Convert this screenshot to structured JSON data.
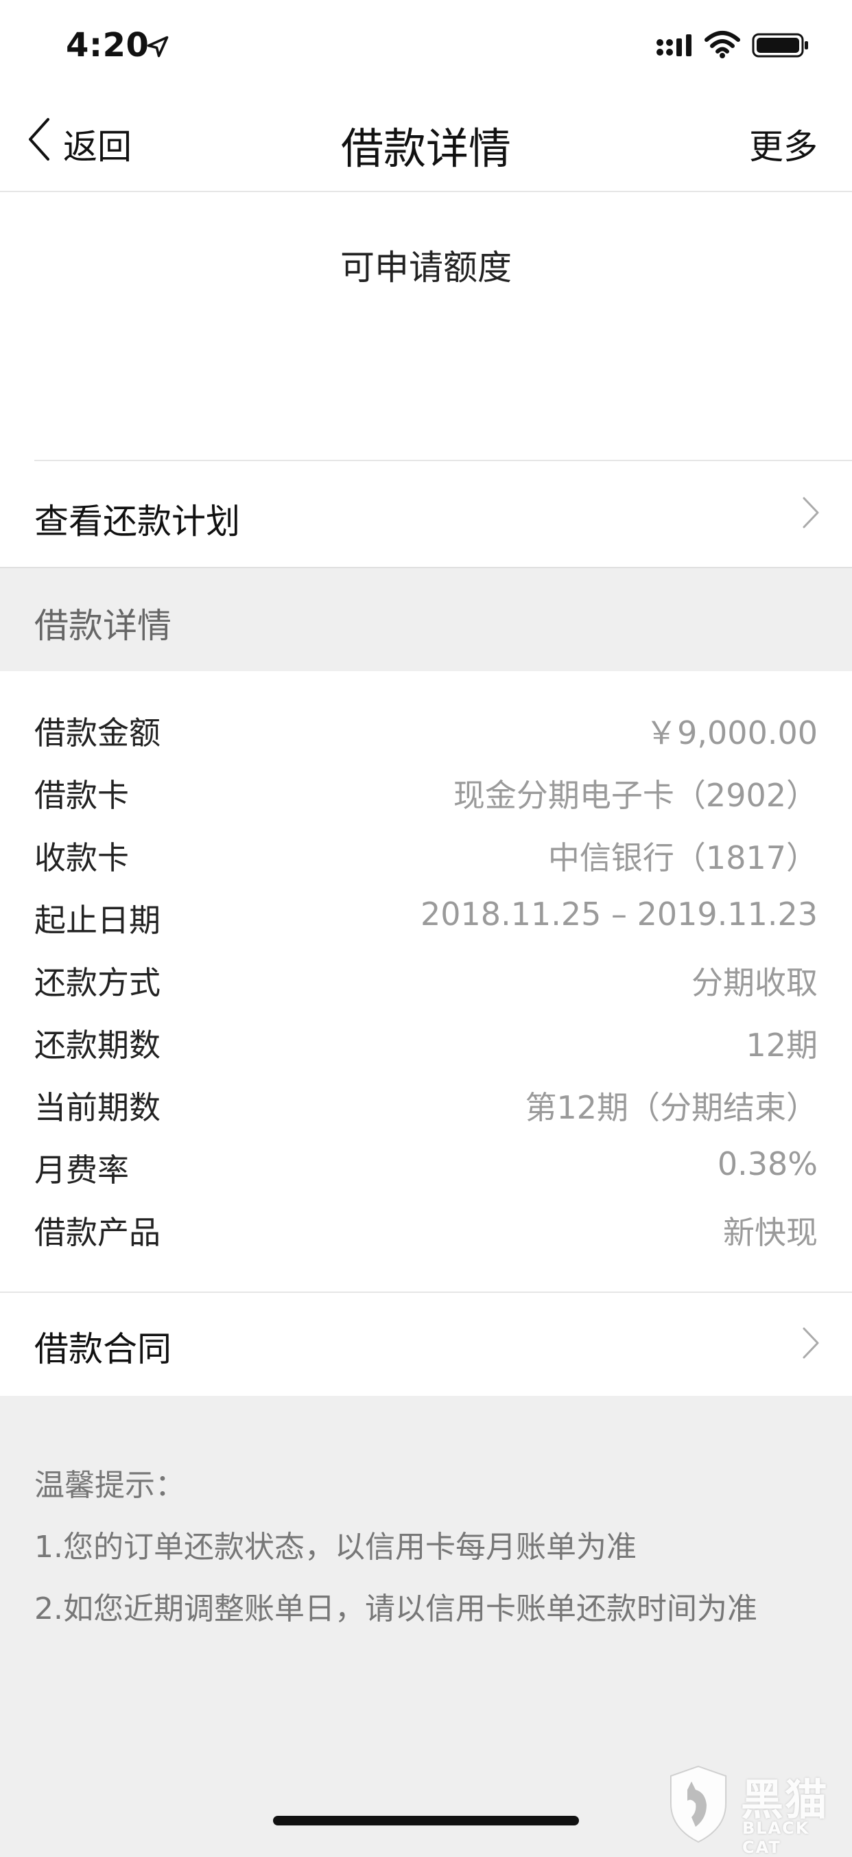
{
  "status_bar": {
    "time": "4:20",
    "icons": [
      "location-arrow-icon",
      "cellular-signal-icon",
      "wifi-icon",
      "battery-icon"
    ]
  },
  "nav": {
    "back_label": "返回",
    "title": "借款详情",
    "more_label": "更多"
  },
  "quota": {
    "label": "可申请额度"
  },
  "plan_row": {
    "label": "查看还款计划"
  },
  "details_section": {
    "header": "借款详情",
    "rows": [
      {
        "key": "借款金额",
        "value": "￥9,000.00"
      },
      {
        "key": "借款卡",
        "value": "现金分期电子卡（2902）"
      },
      {
        "key": "收款卡",
        "value": "中信银行（1817）"
      },
      {
        "key": "起止日期",
        "value": "2018.11.25 – 2019.11.23"
      },
      {
        "key": "还款方式",
        "value": "分期收取"
      },
      {
        "key": "还款期数",
        "value": "12期"
      },
      {
        "key": "当前期数",
        "value": "第12期（分期结束）"
      },
      {
        "key": "月费率",
        "value": "0.38%"
      },
      {
        "key": "借款产品",
        "value": "新快现"
      }
    ]
  },
  "contract_row": {
    "label": "借款合同"
  },
  "tips": {
    "title": "温馨提示：",
    "items": [
      "1.您的订单还款状态，以信用卡每月账单为准",
      "2.如您近期调整账单日，请以信用卡账单还款时间为准"
    ]
  },
  "watermark": {
    "cn": "黑猫",
    "en": "BLACK CAT"
  }
}
